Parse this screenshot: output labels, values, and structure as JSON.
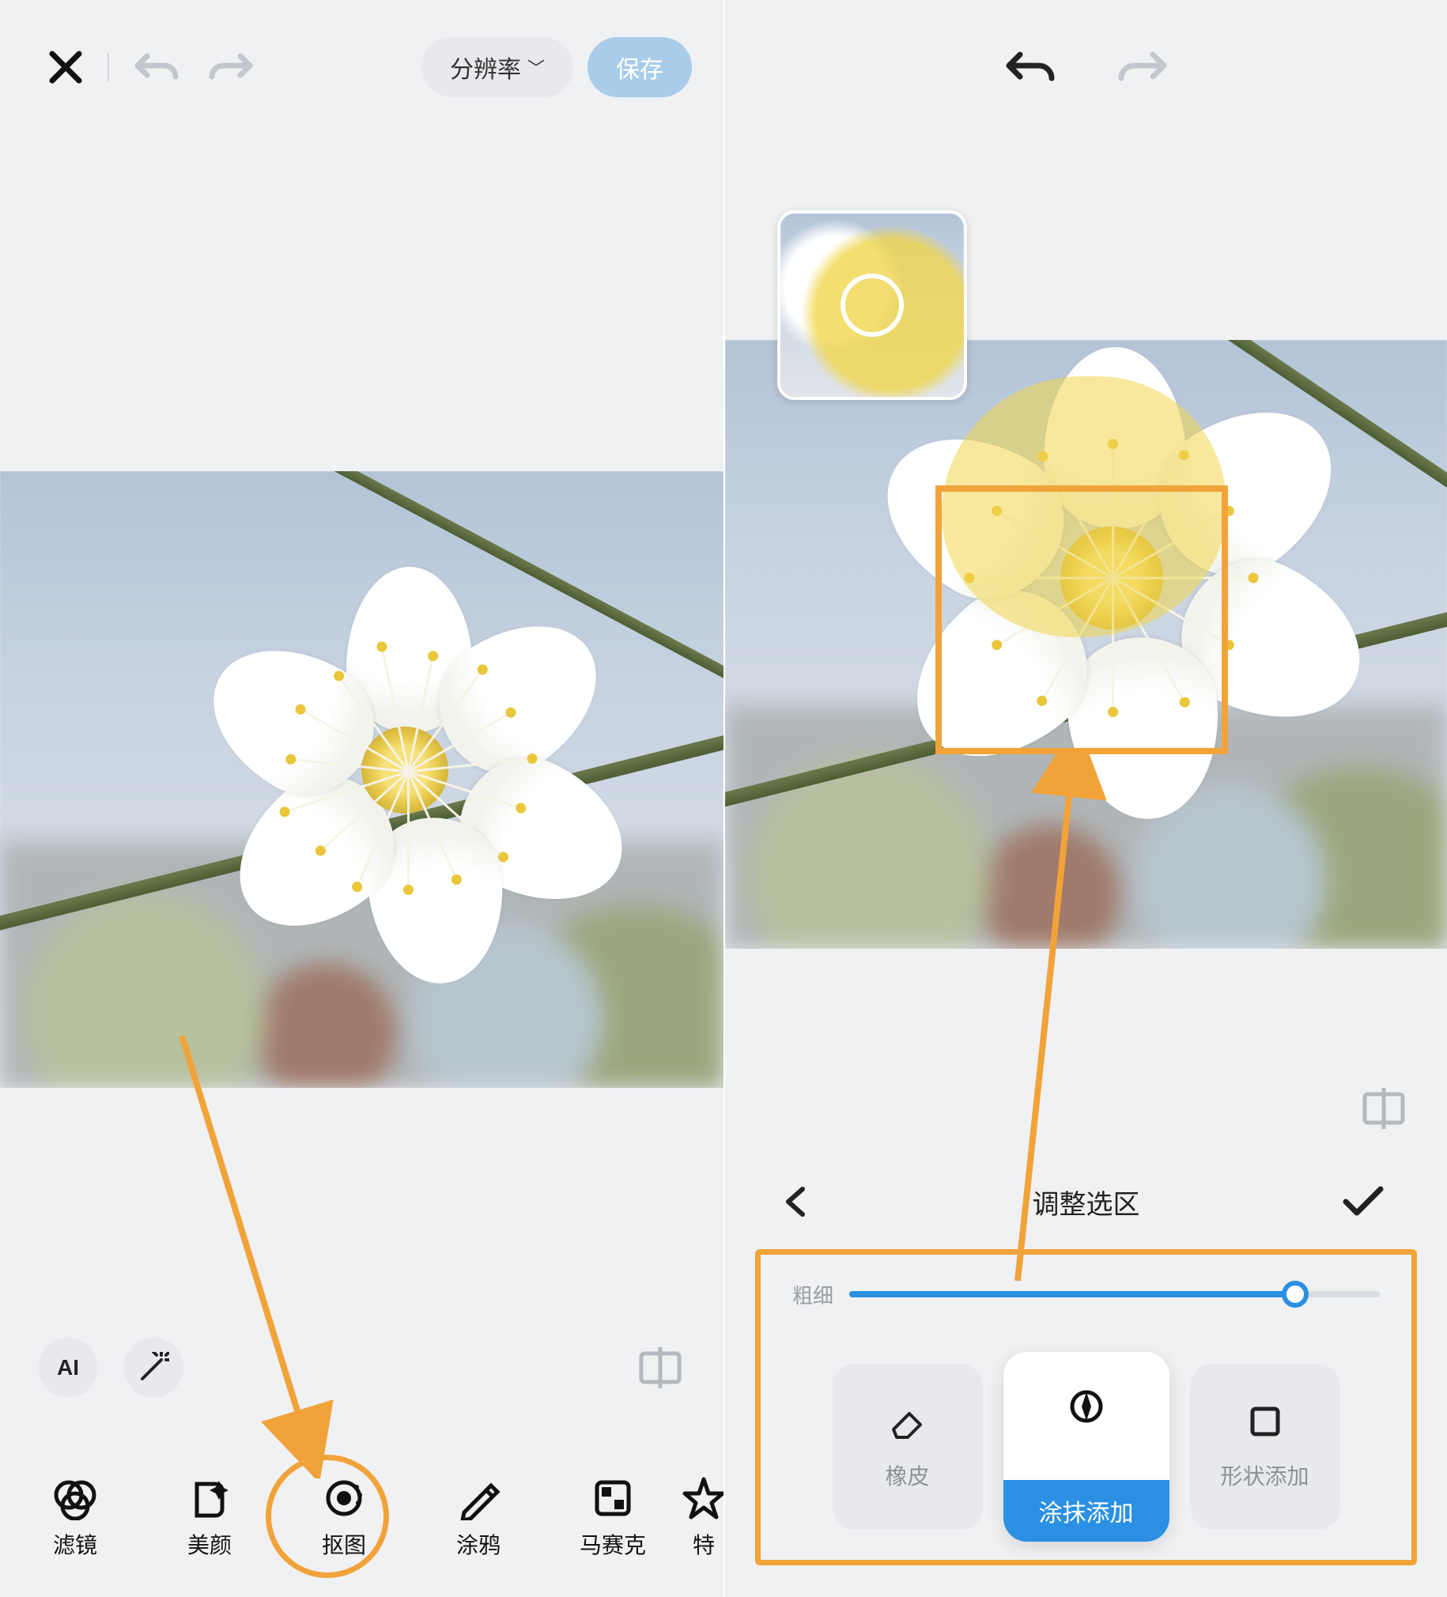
{
  "left": {
    "toolbar": {
      "resolution_label": "分辨率",
      "save_label": "保存"
    },
    "chips": {
      "ai": "AI"
    },
    "tools": {
      "filter": "滤镜",
      "beauty": "美颜",
      "cutout": "抠图",
      "doodle": "涂鸦",
      "mosaic": "马赛克",
      "effects": "特"
    }
  },
  "right": {
    "panel_title": "调整选区",
    "slider_label": "粗细",
    "slider_value_pct": 84,
    "cards": {
      "eraser": "橡皮",
      "brush_add": "涂抹添加",
      "shape_add": "形状添加"
    }
  }
}
